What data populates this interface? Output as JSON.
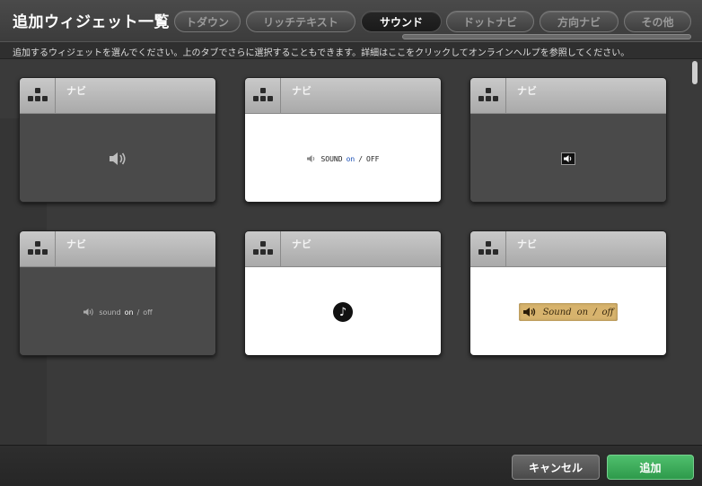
{
  "dialog": {
    "title": "追加ウィジェット一覧"
  },
  "tabs": [
    {
      "label": "トダウン",
      "active": false
    },
    {
      "label": "リッチテキスト",
      "active": false
    },
    {
      "label": "サウンド",
      "active": true
    },
    {
      "label": "ドットナビ",
      "active": false
    },
    {
      "label": "方向ナビ",
      "active": false
    },
    {
      "label": "その他",
      "active": false
    }
  ],
  "info_text": "追加するウィジェットを選んでください。上のタブでさらに選択することもできます。詳細はここをクリックしてオンラインヘルプを参照してください。",
  "cards": [
    {
      "label": "ナビ",
      "style": "dark",
      "preview": "speaker-icon"
    },
    {
      "label": "ナビ",
      "style": "light",
      "preview": "sound-mono",
      "sound": "sound",
      "on": "on",
      "sep": "/",
      "off": "off"
    },
    {
      "label": "ナビ",
      "style": "dark",
      "preview": "mini-speaker-icon"
    },
    {
      "label": "ナビ",
      "style": "dark",
      "preview": "sound-grey",
      "sound": "sound",
      "on": "on",
      "sep": "/",
      "off": "off"
    },
    {
      "label": "ナビ",
      "style": "light",
      "preview": "music-note-icon"
    },
    {
      "label": "ナビ",
      "style": "light",
      "preview": "sound-tape",
      "sound": "Sound",
      "on": "on",
      "sep": "/",
      "off": "off"
    }
  ],
  "footer": {
    "cancel_label": "キャンセル",
    "add_label": "追加"
  },
  "colors": {
    "add_button": "#3aab5a",
    "active_tab": "#1f1f1f"
  }
}
